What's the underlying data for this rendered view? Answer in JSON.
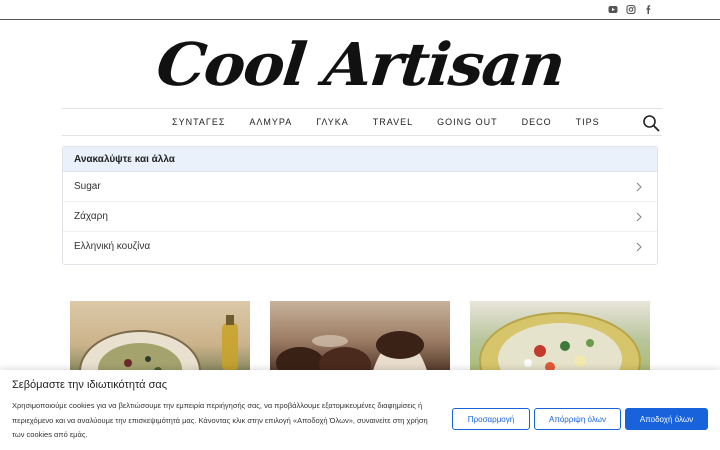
{
  "top_bar": {
    "social_icons": [
      "youtube-icon",
      "instagram-icon",
      "facebook-icon"
    ]
  },
  "logo": {
    "text": "Cool Artisan"
  },
  "nav": {
    "items": [
      "ΣΥΝΤΑΓΕΣ",
      "ΑΛΜΥΡΑ",
      "ΓΛΥΚΑ",
      "TRAVEL",
      "GOING OUT",
      "DECO",
      "TIPS"
    ],
    "search_icon": "search-icon"
  },
  "discover": {
    "heading": "Ανακαλύψτε και άλλα",
    "items": [
      "Sugar",
      "Ζάχαρη",
      "Ελληνική κουζίνα"
    ]
  },
  "cookie_banner": {
    "title": "Σεβόμαστε την ιδιωτικότητά σας",
    "body": "Χρησιμοποιούμε cookies για να βελτιώσουμε την εμπειρία περιήγησής σας, να προβάλλουμε εξατομικευμένες διαφημίσεις ή περιεχόμενο και να αναλύουμε την επισκεψιμότητά μας. Κάνοντας κλικ στην επιλογή «Αποδοχή Όλων», συναινείτε στη χρήση των cookies από εμάς.",
    "customize_label": "Προσαρμογή",
    "reject_label": "Απόρριψη όλων",
    "accept_label": "Αποδοχή όλων",
    "accent_color": "#1863dc"
  }
}
